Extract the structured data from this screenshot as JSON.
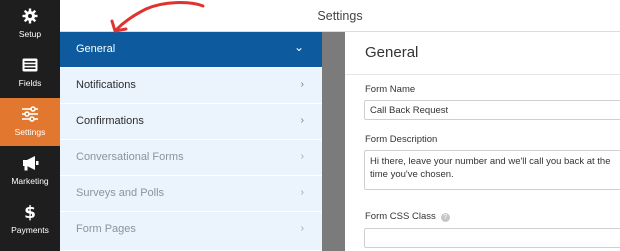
{
  "rail": {
    "items": [
      {
        "label": "Setup",
        "icon": "gear-icon"
      },
      {
        "label": "Fields",
        "icon": "fields-icon"
      },
      {
        "label": "Settings",
        "icon": "sliders-icon"
      },
      {
        "label": "Marketing",
        "icon": "megaphone-icon"
      },
      {
        "label": "Payments",
        "icon": "dollar-icon"
      }
    ],
    "active": "Settings"
  },
  "header": {
    "title": "Settings"
  },
  "nav": {
    "items": [
      {
        "label": "General",
        "chevron": "⌄"
      },
      {
        "label": "Notifications",
        "chevron": "›"
      },
      {
        "label": "Confirmations",
        "chevron": "›"
      },
      {
        "label": "Conversational Forms",
        "chevron": "›"
      },
      {
        "label": "Surveys and Polls",
        "chevron": "›"
      },
      {
        "label": "Form Pages",
        "chevron": "›"
      }
    ]
  },
  "content": {
    "title": "General",
    "form_name": {
      "label": "Form Name",
      "value": "Call Back Request"
    },
    "form_description": {
      "label": "Form Description",
      "value": "Hi there, leave your number and we'll call you back at the time you've chosen."
    },
    "form_css_class": {
      "label": "Form CSS Class",
      "value": ""
    }
  },
  "colors": {
    "rail_bg": "#1e1e1e",
    "rail_active": "#e27730",
    "nav_active": "#0e5a9e",
    "nav_bg": "#ebf3fc",
    "annotation": "#e0332f"
  }
}
